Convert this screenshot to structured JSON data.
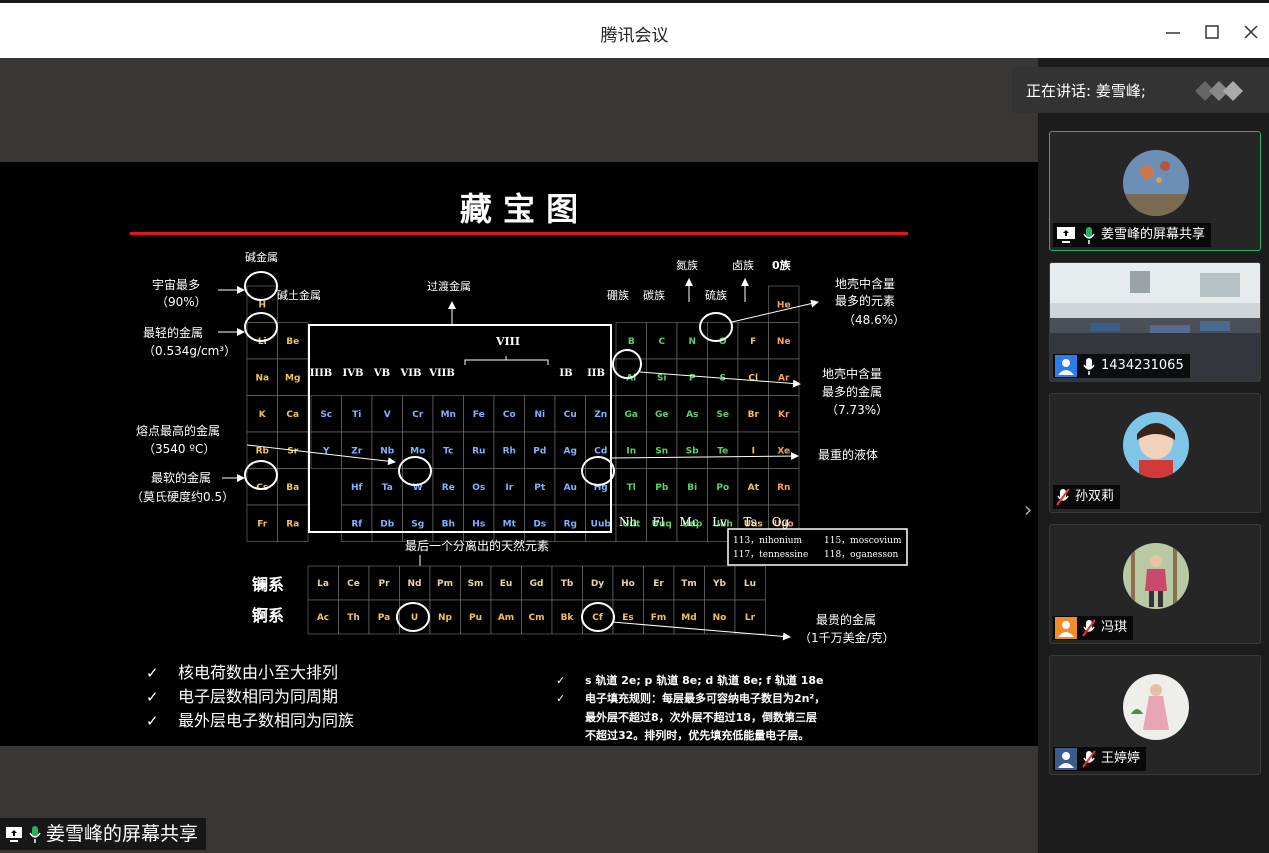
{
  "window": {
    "title": "腾讯会议",
    "minimize_icon": "minimize-icon",
    "maximize_icon": "maximize-icon",
    "close_icon": "close-icon"
  },
  "speaking": {
    "label": "正在讲话: 姜雪峰;"
  },
  "share_label": "姜雪峰的屏幕共享",
  "participants": [
    {
      "name": "姜雪峰的屏幕共享",
      "mic": "mic-on",
      "badge": "screen-share-icon",
      "active": true
    },
    {
      "name": "1434231065",
      "mic": "mic-on",
      "badge": "user-icon",
      "active": false
    },
    {
      "name": "孙双莉",
      "mic": "mic-muted",
      "badge": "",
      "active": false
    },
    {
      "name": "冯琪",
      "mic": "mic-muted",
      "badge": "user-icon",
      "active": false
    },
    {
      "name": "王婷婷",
      "mic": "mic-muted",
      "badge": "user-icon",
      "active": false
    }
  ],
  "slide": {
    "title": "藏 宝 图",
    "group_labels": {
      "alkali": "碱金属",
      "alkaline_earth": "碱土金属",
      "transition": "过渡金属",
      "boron": "硼族",
      "carbon": "碳族",
      "nitrogen": "氮族",
      "sulfur": "硫族",
      "halogen": "卤族",
      "zero": "0族",
      "viii": "VIII"
    },
    "roman_groups": [
      "IIIB",
      "IVB",
      "VB",
      "VIB",
      "VIIB",
      "IB",
      "IIB"
    ],
    "annotations": {
      "universe_most": "宇宙最多",
      "universe_pct": "（90%）",
      "lightest_metal": "最轻的金属",
      "lightest_density": "（0.534g/cm³）",
      "highest_mp": "熔点最高的金属",
      "highest_mp_val": "（3540 ºC）",
      "softest": "最软的金属",
      "softest_val": "（莫氏硬度约0.5）",
      "crust_element": "地壳中含量",
      "crust_element2": "最多的元素",
      "crust_element_pct": "（48.6%）",
      "crust_metal": "地壳中含量",
      "crust_metal2": "最多的金属",
      "crust_metal_pct": "（7.73%）",
      "heaviest_liquid": "最重的液体",
      "last_natural": "最后一个分离出的天然元素",
      "most_expensive": "最贵的金属",
      "most_expensive_val": "（1千万美金/克）"
    },
    "series": {
      "lanthanide": "镧系",
      "actinide": "锕系"
    },
    "new_elements": {
      "row1_left": "113，nihonium",
      "row1_right": "115，moscovium",
      "row2_left": "117，tennessine",
      "row2_right": "118，oganesson"
    },
    "bottom_symbols": [
      "Nh",
      "Fl",
      "Mc",
      "Lv",
      "Ts",
      "Og"
    ],
    "rules_left": [
      "核电荷数由小至大排列",
      "电子层数相同为同周期",
      "最外层电子数相同为同族"
    ],
    "rules_right": {
      "line1": "s 轨道 2e; p 轨道 8e; d 轨道 8e; f 轨道 18e",
      "line2": "电子填充规则：每层最多可容纳电子数目为2n²，",
      "line3": "最外层不超过8，次外层不超过18，倒数第三层",
      "line4": "不超过32。排列时，优先填充低能量电子层。"
    },
    "check": "✓",
    "colors": {
      "title_red": "#e0161b",
      "accent_green": "#27b067"
    }
  }
}
